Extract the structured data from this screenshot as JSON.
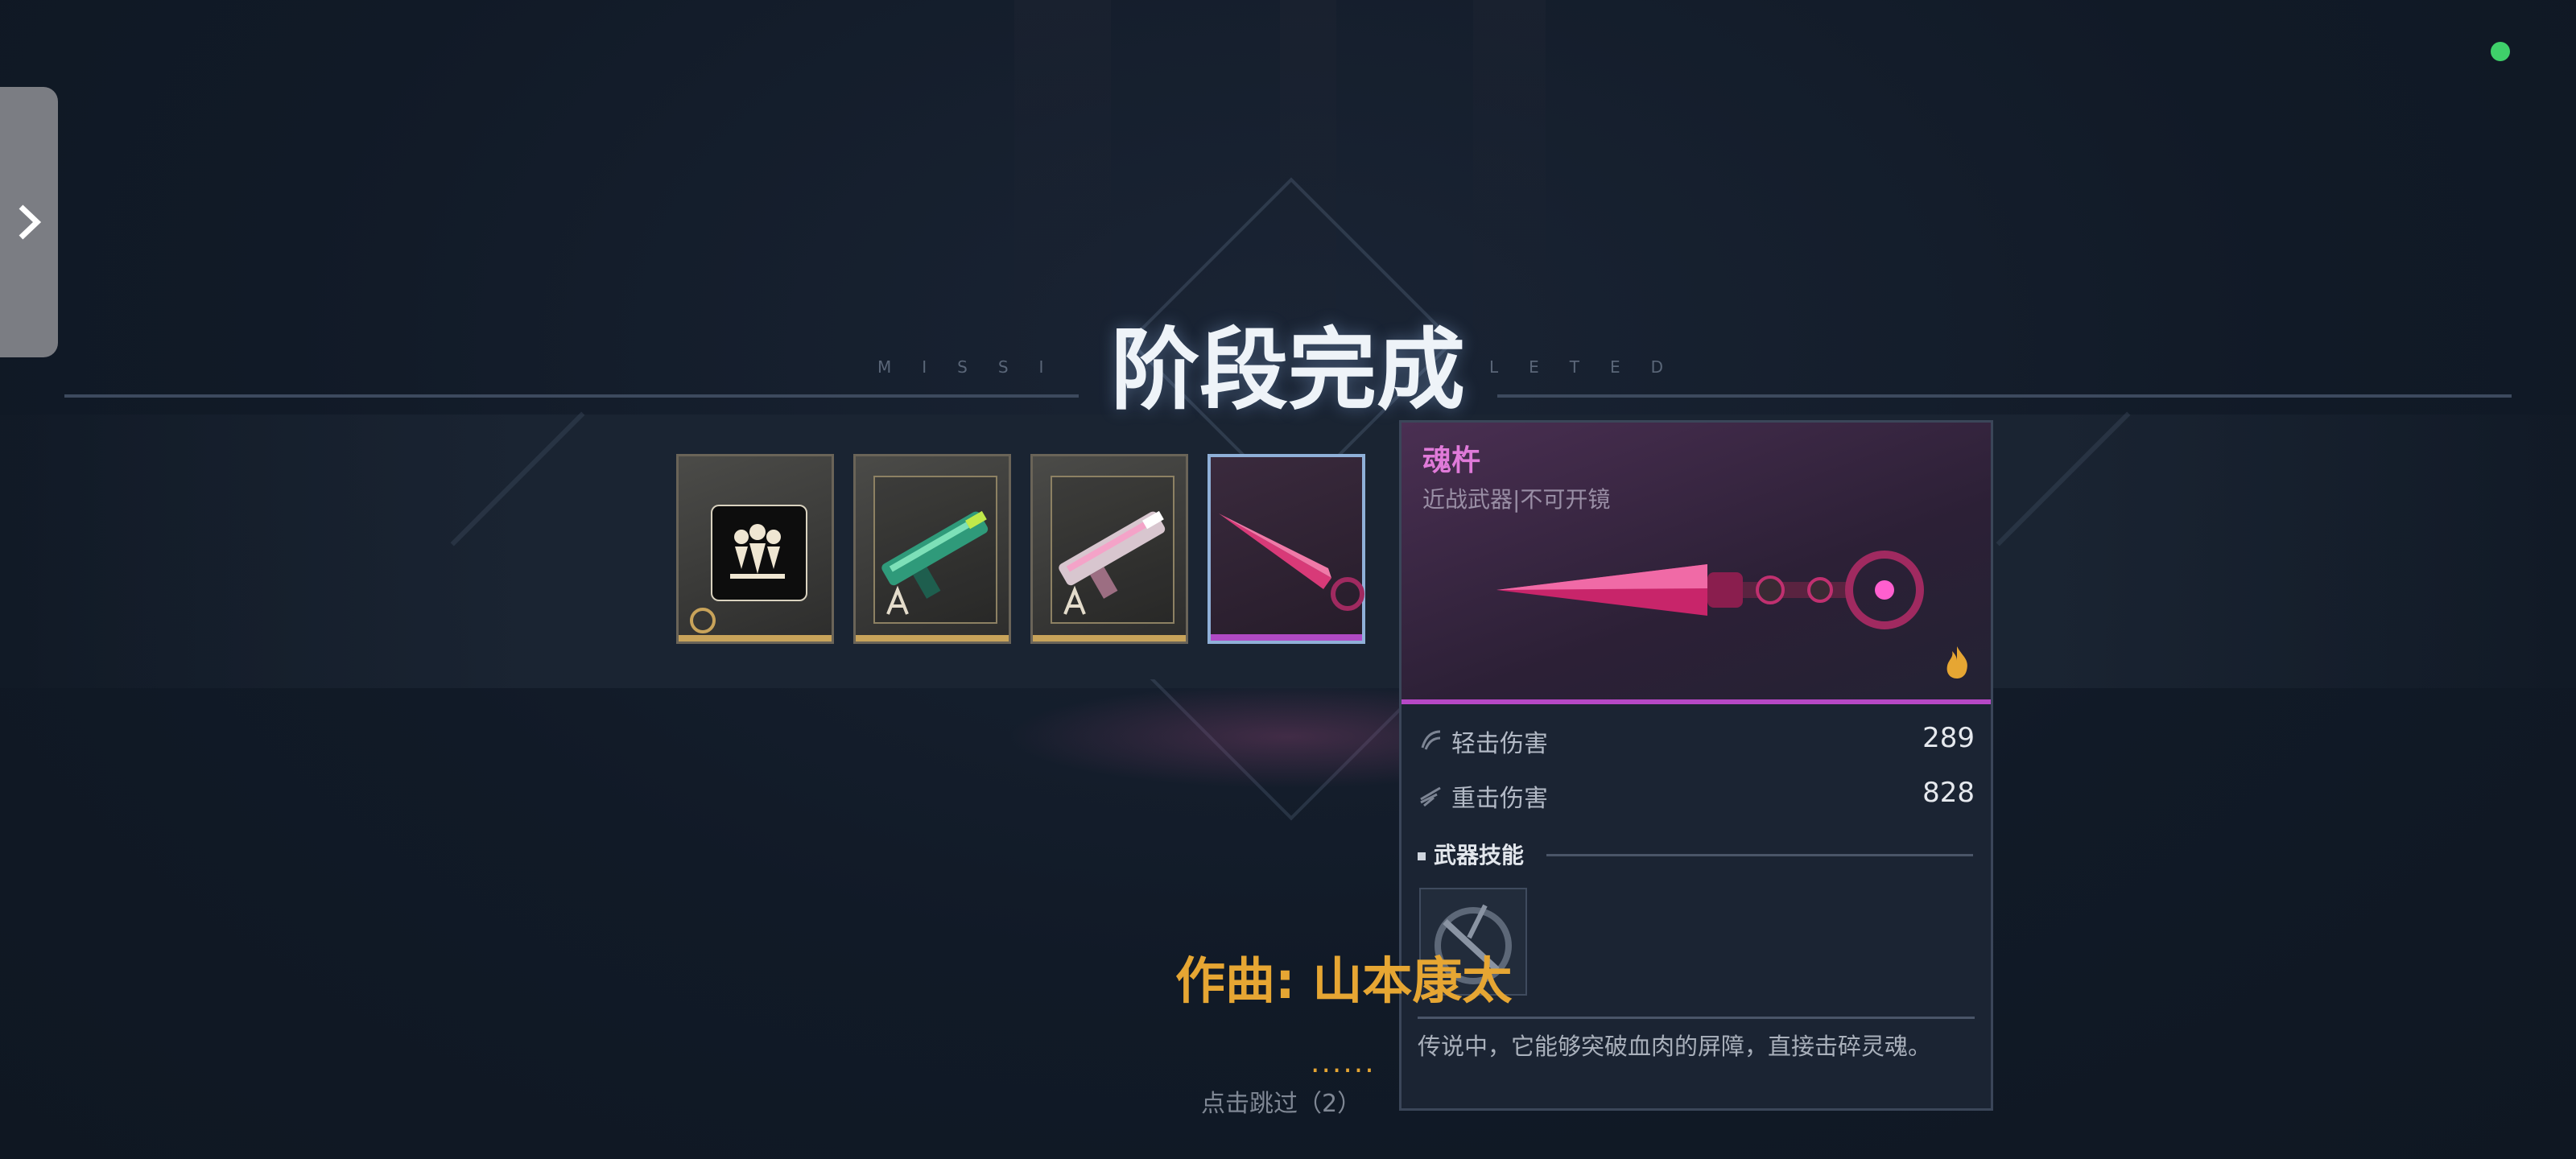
{
  "stage": {
    "title": "阶段完成",
    "subtitle_left": "MISSI",
    "subtitle_right": "LETED"
  },
  "sidebar": {
    "toggle_icon": "chevron-right-icon"
  },
  "status": {
    "indicator_color": "#3fd06a"
  },
  "rewards": {
    "items": [
      {
        "name": "squad-emblem",
        "icon": "squad-emblem-icon",
        "rarity_color": "#c8a35a"
      },
      {
        "name": "green-gun",
        "icon": "rifle-icon",
        "rarity_color": "#c8a35a"
      },
      {
        "name": "pink-gun",
        "icon": "rifle-icon",
        "rarity_color": "#c8a35a"
      },
      {
        "name": "soul-pestle",
        "icon": "dagger-icon",
        "rarity_color": "#b04ac4",
        "selected": true
      }
    ]
  },
  "tooltip": {
    "name": "魂杵",
    "type": "近战武器|不可开镜",
    "element_icon": "fire-icon",
    "accent_color": "#b648c6",
    "stats": [
      {
        "label": "轻击伤害",
        "value": "289",
        "icon": "light-attack-icon"
      },
      {
        "label": "重击伤害",
        "value": "828",
        "icon": "heavy-attack-icon"
      }
    ],
    "skill_header": "武器技能",
    "skill_icon": "skill-icon",
    "description": "传说中，它能够突破血肉的屏障，直接击碎灵魂。"
  },
  "subtitle": {
    "credit": "作曲: 山本康太",
    "dots": "......",
    "skip": "点击跳过（2）"
  }
}
